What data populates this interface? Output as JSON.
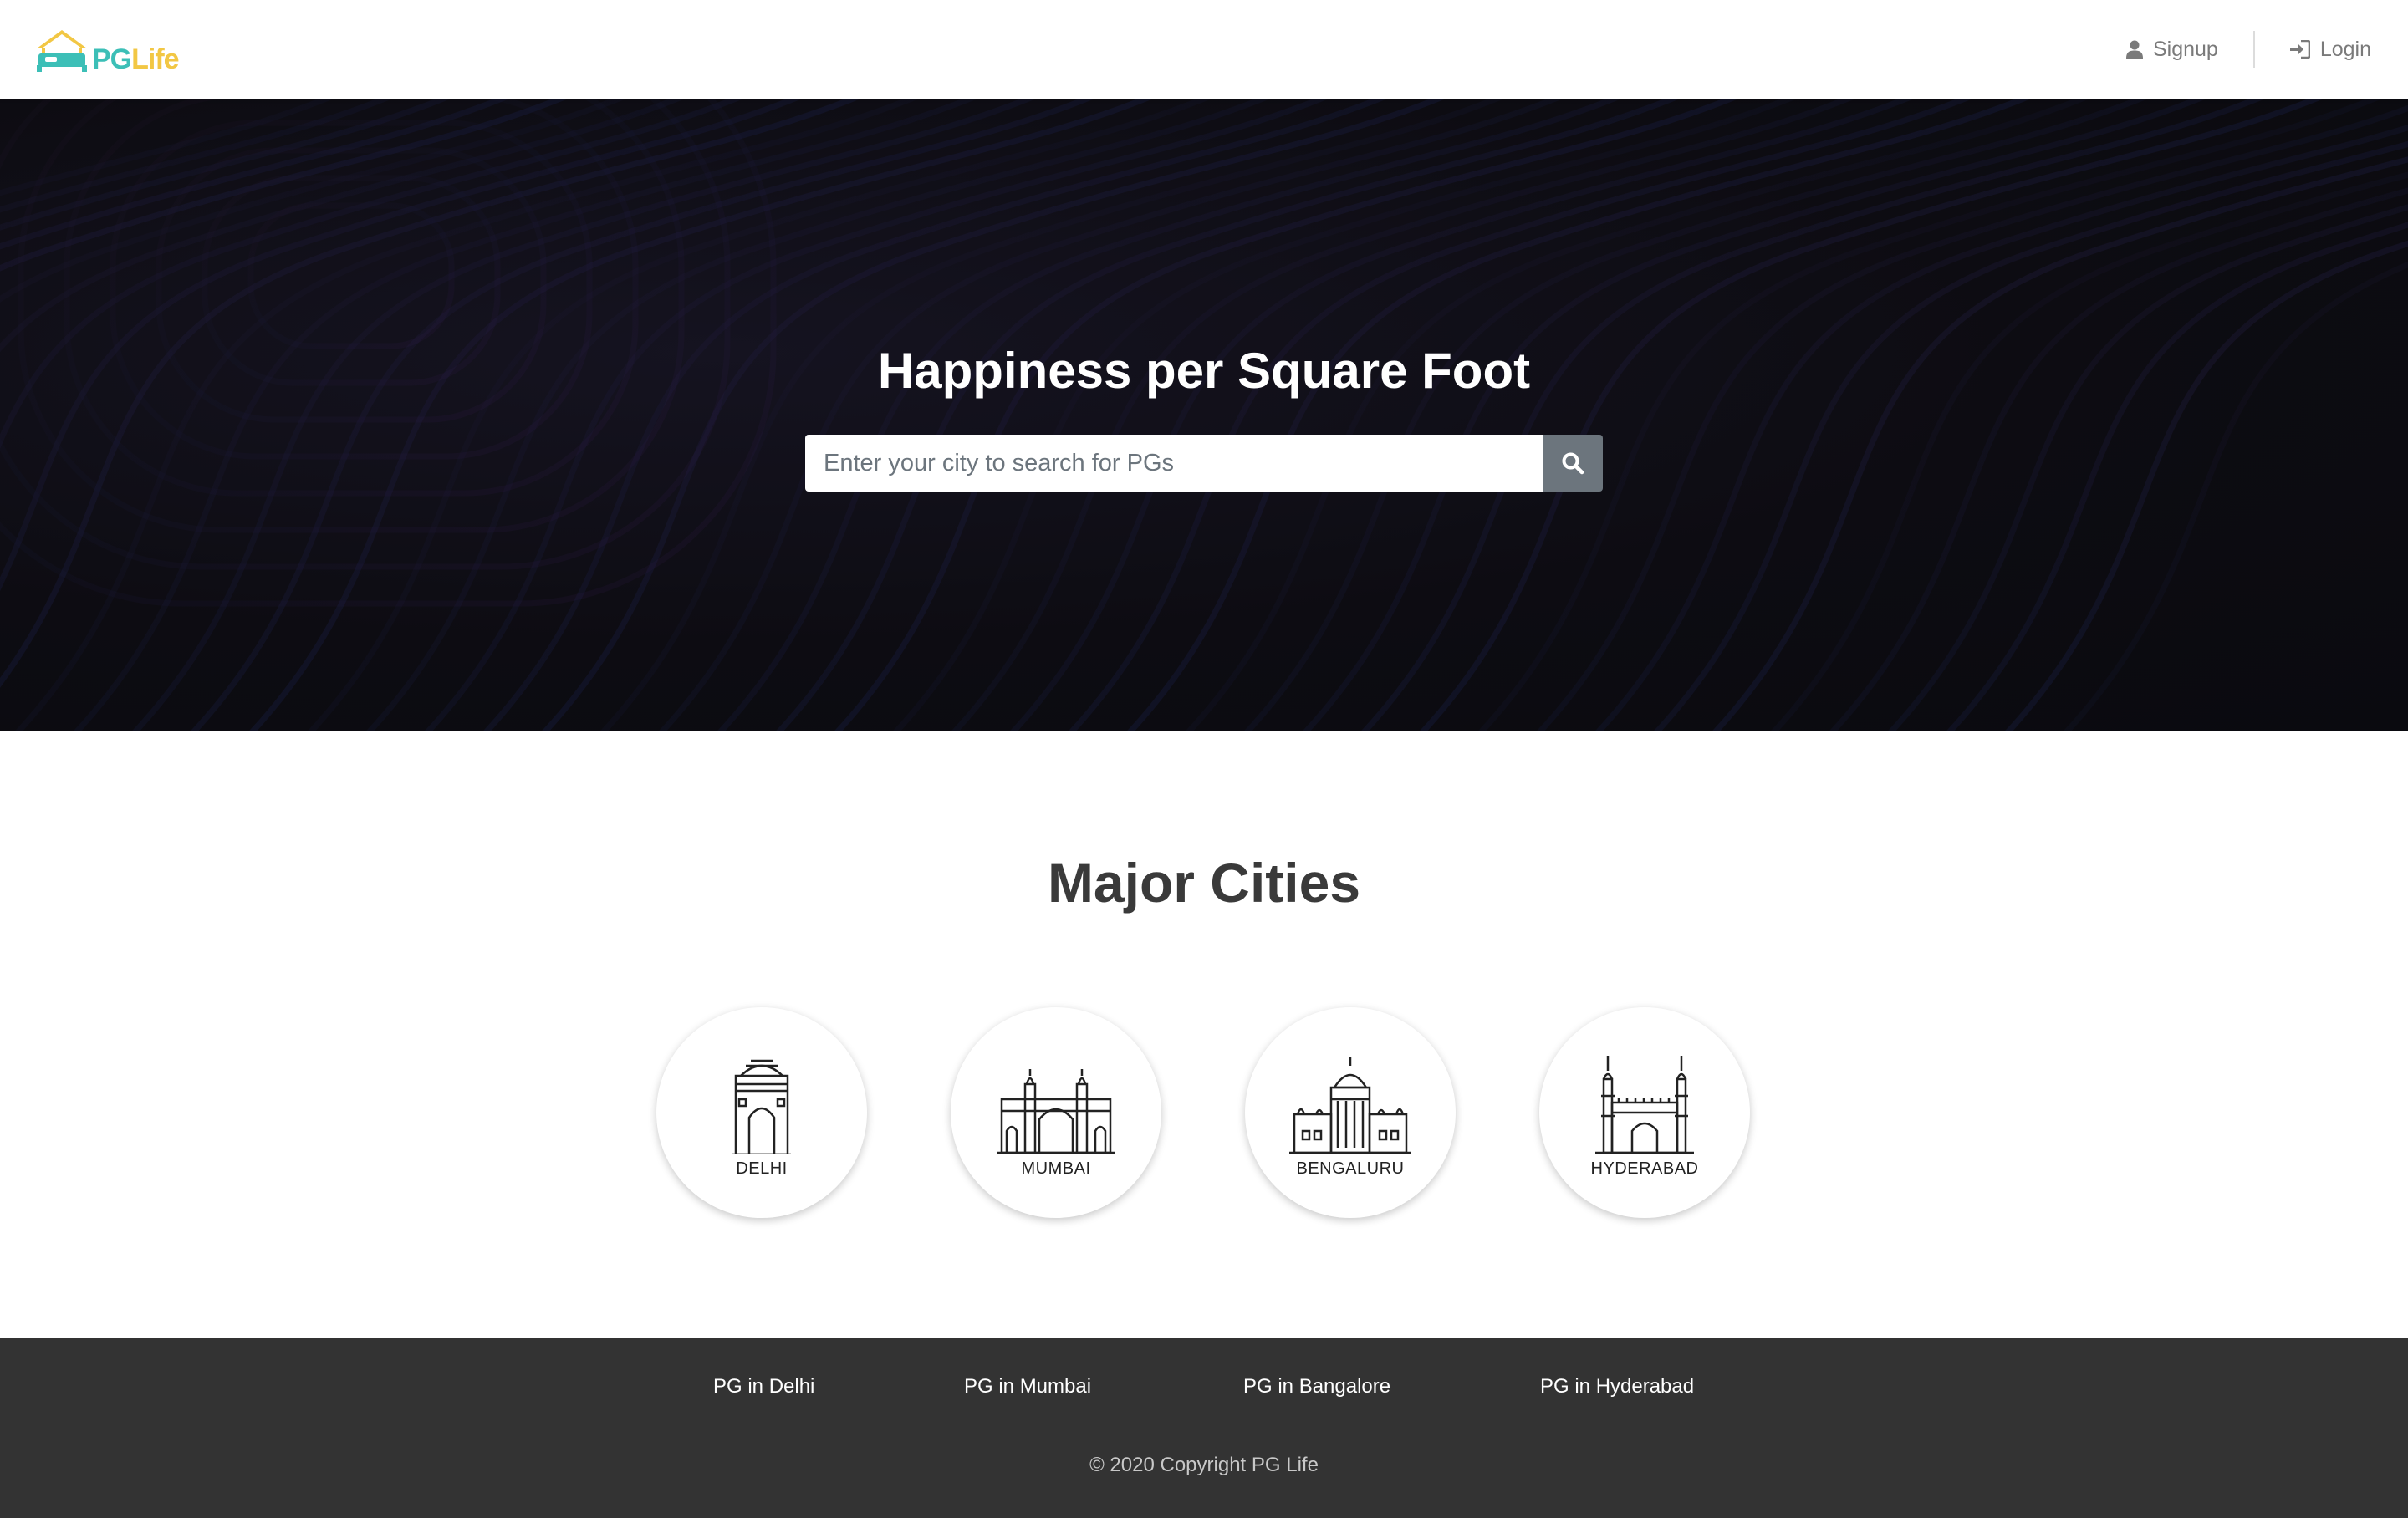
{
  "navbar": {
    "brand_pg": "PG",
    "brand_life": "Life",
    "signup_label": "Signup",
    "login_label": "Login"
  },
  "hero": {
    "title": "Happiness per Square Foot",
    "search_placeholder": "Enter your city to search for PGs",
    "search_value": ""
  },
  "cities_section": {
    "title": "Major Cities",
    "cities": [
      {
        "name": "DELHI",
        "icon": "india-gate-icon"
      },
      {
        "name": "MUMBAI",
        "icon": "gateway-of-india-icon"
      },
      {
        "name": "BENGALURU",
        "icon": "vidhana-soudha-icon"
      },
      {
        "name": "HYDERABAD",
        "icon": "charminar-icon"
      }
    ]
  },
  "footer": {
    "links": [
      "PG in Delhi",
      "PG in Mumbai",
      "PG in Bangalore",
      "PG in Hyderabad"
    ],
    "copyright": "© 2020 Copyright PG Life"
  },
  "colors": {
    "brand_teal": "#3cbfb7",
    "brand_yellow": "#f2c744",
    "hero_dark": "#0d0c12",
    "search_button": "#6c757d",
    "footer_bg": "#333333"
  }
}
